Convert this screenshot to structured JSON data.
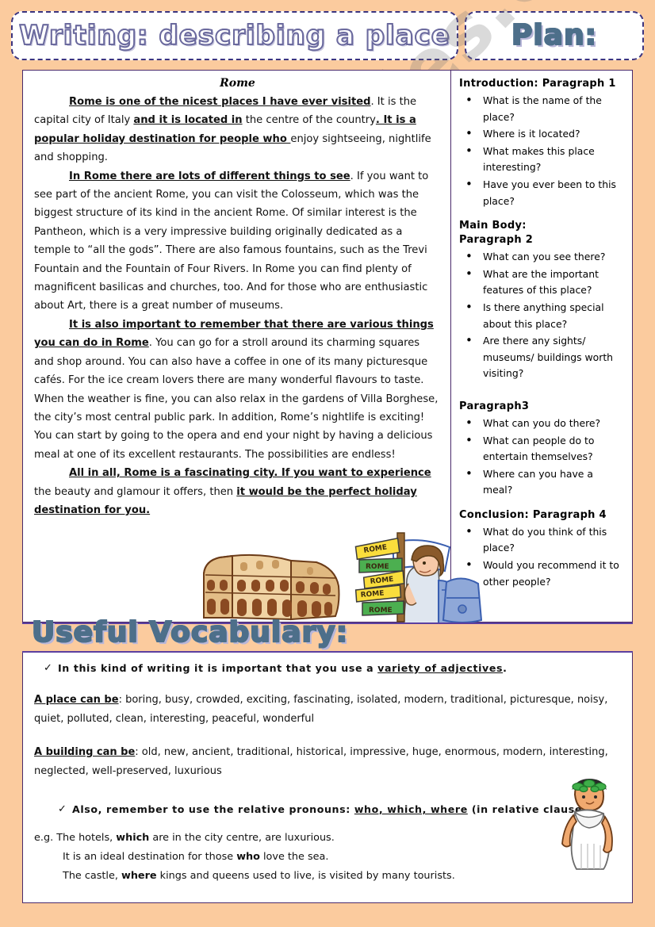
{
  "theme": {
    "page_background": "#fbcb9e",
    "border_color": "#4a2a6b",
    "title_ink": "#6b6a9e",
    "plan_ink": "#4d6f8a",
    "paper": "#ffffff"
  },
  "watermark": {
    "text": "ESLprintables.com"
  },
  "header": {
    "title": "Writing: describing a place",
    "plan_label": "Plan:"
  },
  "essay": {
    "title": "Rome",
    "paragraphs": [
      {
        "id": "p1",
        "runs": [
          {
            "text": "Rome is one of the nicest places I have ever visited",
            "style": "bold-underline"
          },
          {
            "text": ". It is the capital city of Italy ",
            "style": "plain"
          },
          {
            "text": "and it is located in",
            "style": "bold-underline"
          },
          {
            "text": " the centre of the country",
            "style": "plain"
          },
          {
            "text": ". It is a popular holiday destination for people who ",
            "style": "bold-underline"
          },
          {
            "text": "enjoy sightseeing, nightlife and shopping.",
            "style": "plain"
          }
        ]
      },
      {
        "id": "p2",
        "runs": [
          {
            "text": "In Rome there are lots of different things to see",
            "style": "bold-underline"
          },
          {
            "text": ". If you want to see part of the ancient Rome, you can visit the Colosseum, which was the biggest structure of its kind in the ancient Rome. Of similar interest is the Pantheon, which is a very impressive building originally dedicated as a temple to “all the gods”. There are also famous fountains, such as the Trevi Fountain and the Fountain of Four Rivers. In Rome you can find plenty of magnificent basilicas and churches, too. And for those who are enthusiastic about Art, there is a great number of museums.",
            "style": "plain"
          }
        ]
      },
      {
        "id": "p3",
        "runs": [
          {
            "text": "It is also important to remember that there are various things you can do in Rome",
            "style": "bold-underline"
          },
          {
            "text": ". You can go for a stroll around its charming squares and shop around. You can also have a coffee in one of its many picturesque cafés.  For the ice cream lovers there are many wonderful flavours to taste. When the weather is fine, you can also relax in the gardens of Villa Borghese, the city’s most central public park. In addition, Rome’s nightlife is exciting! You can start by going to the opera and end your night by having a delicious meal at one of its excellent restaurants. The possibilities are endless!",
            "style": "plain"
          }
        ]
      },
      {
        "id": "p4",
        "runs": [
          {
            "text": "All in all, Rome is a fascinating city. If you want to experience",
            "style": "bold-underline"
          },
          {
            "text": " the beauty and glamour it offers, then ",
            "style": "plain"
          },
          {
            "text": "it would be the perfect holiday destination for you.",
            "style": "bold-underline"
          }
        ]
      }
    ]
  },
  "plan": {
    "sections": [
      {
        "heading": "Introduction:  Paragraph  1",
        "items": [
          "What is the name of the place?",
          "Where is it located?",
          "What makes this place interesting?",
          "Have you ever been to this place?"
        ]
      },
      {
        "heading": "Main  Body:\nParagraph  2",
        "heading_lines": [
          "Main  Body:",
          "Paragraph  2"
        ],
        "items": [
          "What can you see there?",
          "What are the important features of this place?",
          "Is there anything special about this place?",
          "Are there any sights/ museums/ buildings worth visiting?"
        ]
      },
      {
        "heading": "Paragraph3",
        "items": [
          "What can you do there?",
          "What can people do to entertain themselves?",
          "Where can you have a meal?"
        ]
      },
      {
        "heading": "Conclusion:  Paragraph  4",
        "items": [
          "What do you think of this place?",
          "Would you recommend it to other people?"
        ]
      }
    ]
  },
  "vocabulary": {
    "banner_label": "Useful Vocabulary:",
    "tip_1_pre": "In this kind of writing it is important that you use a ",
    "tip_1_underline": "variety of adjectives",
    "tip_1_post": ".",
    "rows": [
      {
        "lead": "A place can be",
        "colon": ":",
        "words": "boring, busy, crowded, exciting, fascinating, isolated, modern, traditional, picturesque, noisy, quiet, polluted, clean, interesting, peaceful, wonderful"
      },
      {
        "lead": "A building can be",
        "colon": ":",
        "words": "old, new, ancient, traditional, historical, impressive, huge, enormous, modern, interesting, neglected, well-preserved, luxurious"
      }
    ],
    "tip_2_pre": "Also, remember to use the relative pronouns: ",
    "tip_2_underline": "who, which, where",
    "tip_2_post": " (in relative clauses).",
    "examples": [
      {
        "prefix": "e.g. The hotels, ",
        "bold": "which",
        "suffix": " are in the city centre, are luxurious.",
        "indent": false
      },
      {
        "prefix": "It is an ideal destination for those ",
        "bold": "who",
        "suffix": " love the sea.",
        "indent": true
      },
      {
        "prefix": "The castle, ",
        "bold": "where",
        "suffix": " kings and queens used to live, is visited by many tourists.",
        "indent": true
      }
    ]
  },
  "clipart": {
    "colosseum": "colosseum-illustration",
    "signpost": "rome-signpost-illustration",
    "signpost_labels": [
      "ROME",
      "ROME",
      "ROME",
      "ROME",
      "ROME"
    ],
    "tourist": "tourist-with-backpack-illustration",
    "roman": "roman-citizen-with-laurel-wreath-illustration"
  }
}
